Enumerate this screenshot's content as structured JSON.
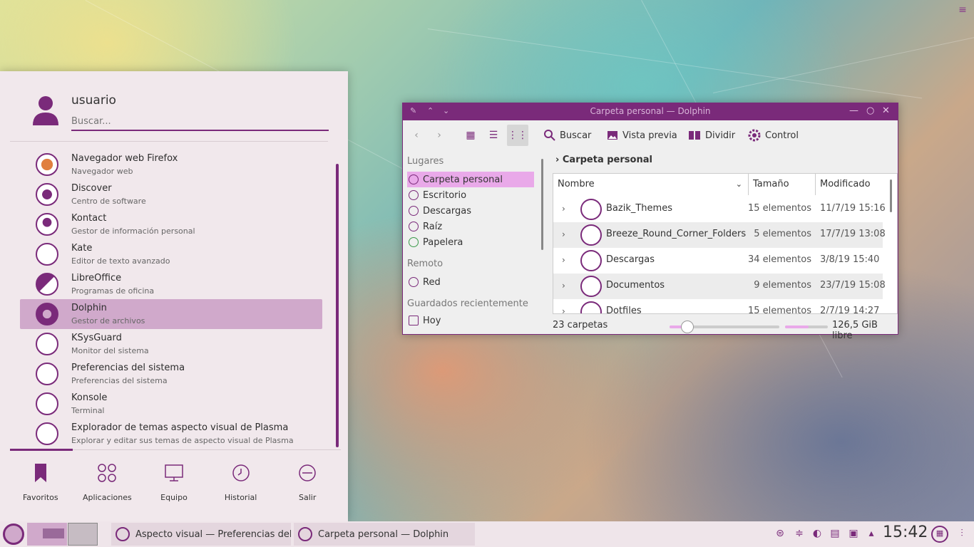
{
  "desktop": {
    "corner_menu": "≡"
  },
  "launcher": {
    "user_name": "usuario",
    "search_placeholder": "Buscar...",
    "apps": [
      {
        "name": "Navegador web Firefox",
        "desc": "Navegador web",
        "icon": "firefox-icon"
      },
      {
        "name": "Discover",
        "desc": "Centro de software",
        "icon": "discover-icon"
      },
      {
        "name": "Kontact",
        "desc": "Gestor de información personal",
        "icon": "kontact-icon"
      },
      {
        "name": "Kate",
        "desc": "Editor de texto avanzado",
        "icon": "kate-icon"
      },
      {
        "name": "LibreOffice",
        "desc": "Programas de oficina",
        "icon": "libreoffice-icon"
      },
      {
        "name": "Dolphin",
        "desc": "Gestor de archivos",
        "icon": "dolphin-icon",
        "selected": true
      },
      {
        "name": "KSysGuard",
        "desc": "Monitor del sistema",
        "icon": "ksysguard-icon"
      },
      {
        "name": "Preferencias del sistema",
        "desc": "Preferencias del sistema",
        "icon": "settings-icon"
      },
      {
        "name": "Konsole",
        "desc": "Terminal",
        "icon": "konsole-icon"
      },
      {
        "name": "Explorador de temas aspecto visual de Plasma",
        "desc": "Explorar y editar sus temas de aspecto visual de Plasma",
        "icon": "theme-explorer-icon"
      }
    ],
    "tabs": [
      {
        "label": "Favoritos",
        "icon": "bookmark-icon"
      },
      {
        "label": "Aplicaciones",
        "icon": "apps-grid-icon"
      },
      {
        "label": "Equipo",
        "icon": "computer-icon"
      },
      {
        "label": "Historial",
        "icon": "history-icon"
      },
      {
        "label": "Salir",
        "icon": "logout-icon"
      }
    ]
  },
  "dolphin": {
    "title": "Carpeta personal — Dolphin",
    "toolbar": {
      "search": "Buscar",
      "preview": "Vista previa",
      "split": "Dividir",
      "control": "Control"
    },
    "places": {
      "heading_places": "Lugares",
      "items": [
        {
          "label": "Carpeta personal",
          "selected": true
        },
        {
          "label": "Escritorio"
        },
        {
          "label": "Descargas"
        },
        {
          "label": "Raíz"
        },
        {
          "label": "Papelera"
        }
      ],
      "heading_remote": "Remoto",
      "remote_item": "Red",
      "heading_recent": "Guardados recientemente",
      "recent_item": "Hoy"
    },
    "breadcrumb": "Carpeta personal",
    "columns": {
      "name": "Nombre",
      "size": "Tamaño",
      "modified": "Modificado"
    },
    "rows": [
      {
        "name": "Bazik_Themes",
        "size": "15 elementos",
        "date": "11/7/19 15:16"
      },
      {
        "name": "Breeze_Round_Corner_Folders",
        "size": "5 elementos",
        "date": "17/7/19 13:08"
      },
      {
        "name": "Descargas",
        "size": "34 elementos",
        "date": "3/8/19 15:40"
      },
      {
        "name": "Documentos",
        "size": "9 elementos",
        "date": "23/7/19 15:08"
      },
      {
        "name": "Dotfiles",
        "size": "15 elementos",
        "date": "2/7/19 14:27"
      }
    ],
    "status": {
      "count": "23 carpetas",
      "free": "126,5 GiB libre",
      "zoom_fraction": 0.16,
      "disk_used_fraction": 0.55
    }
  },
  "taskbar": {
    "tasks": [
      {
        "label": "Aspecto visual  — Preferencias del...",
        "icon": "settings-icon"
      },
      {
        "label": "Carpeta personal — Dolphin",
        "icon": "dolphin-icon"
      }
    ],
    "clock": "15:42"
  },
  "colors": {
    "accent": "#7a2a7a",
    "selection": "#d0a9cb",
    "places_selection": "#e9a9e9"
  }
}
